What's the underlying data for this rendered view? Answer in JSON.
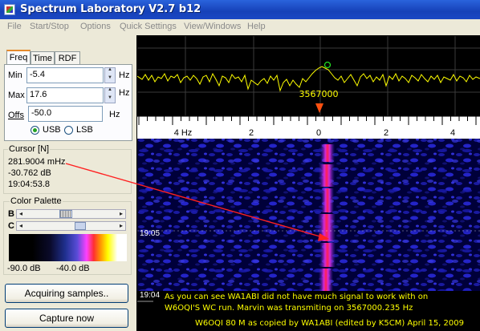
{
  "window": {
    "title": "Spectrum Laboratory V2.7 b12"
  },
  "menu": [
    "File",
    "Start/Stop",
    "Options",
    "Quick Settings",
    "View/Windows",
    "Help"
  ],
  "tabs": [
    "Freq",
    "Time",
    "RDF"
  ],
  "freq": {
    "min_label": "Min",
    "min_value": "-5.4",
    "min_unit": "Hz",
    "max_label": "Max",
    "max_value": "17.6",
    "max_unit": "Hz",
    "offs_label": "Offs",
    "offs_value": "-50.0",
    "offs_unit": "Hz",
    "usb_label": "USB",
    "lsb_label": "LSB",
    "selected_mode": "USB"
  },
  "cursor": {
    "title": "Cursor [N]",
    "frequency": "281.9004 mHz",
    "level": "-30.762 dB",
    "time": "19:04:53.8"
  },
  "palette": {
    "title": "Color Palette",
    "b_label": "B",
    "c_label": "C",
    "b_position": 0.45,
    "c_position": 0.58,
    "min_label": "-90.0 dB",
    "max_label": "-40.0 dB"
  },
  "buttons": {
    "acquiring": "Acquiring samples..",
    "capture": "Capture now"
  },
  "spectrum": {
    "marker_freq": "3567000"
  },
  "axis": {
    "ticks": [
      "4 Hz",
      "2",
      "0",
      "2",
      "4"
    ]
  },
  "waterfall": {
    "time_labels": [
      "19:05",
      "19:04"
    ]
  },
  "annotation": {
    "line1": "As you can see WA1ABI did not have much signal to work with on",
    "line2": "W6OQI'S WC run.  Marvin was transmiting on 3567000.235 Hz",
    "footer": "W6OQI 80 M as copied by WA1ABI (edited by K5CM) April 15, 2009"
  },
  "colors": {
    "trace": "#ffff00",
    "marker": "#ff5010",
    "arrow": "#ff2020",
    "annotation": "#ffff00"
  }
}
